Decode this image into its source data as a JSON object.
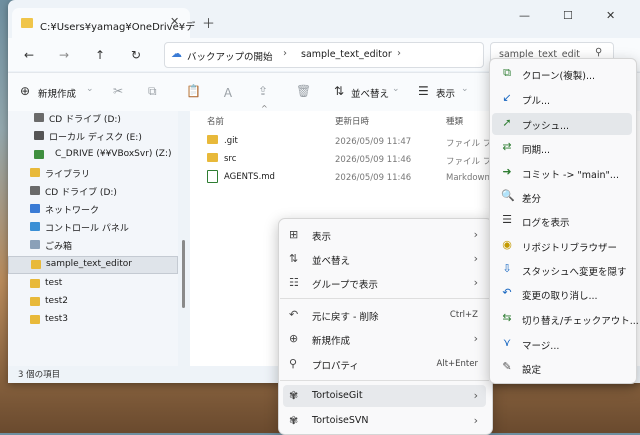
{
  "window": {
    "tab_title": "C:¥Users¥yamag¥OneDrive¥デ",
    "minimize": "—",
    "maximize": "☐",
    "close": "✕"
  },
  "nav": {
    "back": "←",
    "forward": "→",
    "up": "↑",
    "refresh": "↻",
    "breadcrumb": [
      "バックアップの開始",
      "sample_text_editor"
    ],
    "search_placeholder": "sample_text_edit"
  },
  "toolbar": {
    "new_label": "新規作成",
    "sort_label": "並べ替え",
    "view_label": "表示"
  },
  "sidebar": {
    "items": [
      {
        "label": "CD ドライブ (D:)",
        "color": "#6a6a6a"
      },
      {
        "label": "ローカル ディスク (E:)",
        "color": "#555555"
      },
      {
        "label": "C_DRIVE (¥¥VBoxSvr) (Z:)",
        "color": "#3f8f3f"
      },
      {
        "label": "ライブラリ",
        "color": "#e8b93a"
      },
      {
        "label": "CD ドライブ (D:)",
        "color": "#6a6a6a"
      },
      {
        "label": "ネットワーク",
        "color": "#3a7bd5"
      },
      {
        "label": "コントロール パネル",
        "color": "#3a8fd5"
      },
      {
        "label": "ごみ箱",
        "color": "#8aa0b8"
      },
      {
        "label": "sample_text_editor",
        "color": "#e8b93a"
      },
      {
        "label": "test",
        "color": "#e8b93a"
      },
      {
        "label": "test2",
        "color": "#e8b93a"
      },
      {
        "label": "test3",
        "color": "#e8b93a"
      }
    ]
  },
  "files": {
    "headers": [
      "名前",
      "更新日時",
      "種類"
    ],
    "rows": [
      {
        "name": ".git",
        "date": "2026/05/09 11:47",
        "type": "ファイル フォ"
      },
      {
        "name": "src",
        "date": "2026/05/09 11:46",
        "type": "ファイル フォ"
      },
      {
        "name": "AGENTS.md",
        "date": "2026/05/09 11:46",
        "type": "Markdown"
      }
    ]
  },
  "status": "3 個の項目",
  "context_menu": {
    "items": [
      {
        "label": "表示",
        "icon": "⊞",
        "arrow": true
      },
      {
        "label": "並べ替え",
        "icon": "⇅",
        "arrow": true
      },
      {
        "label": "グループで表示",
        "icon": "☷",
        "arrow": true
      },
      {
        "label": "元に戻す - 削除",
        "icon": "↶",
        "shortcut": "Ctrl+Z"
      },
      {
        "label": "新規作成",
        "icon": "⊕",
        "arrow": true
      },
      {
        "label": "プロパティ",
        "icon": "⚲",
        "shortcut": "Alt+Enter"
      },
      {
        "label": "TortoiseGit",
        "icon": "✾",
        "arrow": true
      },
      {
        "label": "TortoiseSVN",
        "icon": "✾",
        "arrow": true
      }
    ]
  },
  "submenu": {
    "items": [
      {
        "label": "クローン(複製)...",
        "icon": "⧉",
        "color": "#2e7d32"
      },
      {
        "label": "プル...",
        "icon": "↙",
        "color": "#1565c0"
      },
      {
        "label": "プッシュ...",
        "icon": "➚",
        "color": "#2e7d32"
      },
      {
        "label": "同期...",
        "icon": "⇄",
        "color": "#2e7d32"
      },
      {
        "label": "コミット -> \"main\"...",
        "icon": "➜",
        "color": "#2e7d32"
      },
      {
        "label": "差分",
        "icon": "🔍",
        "color": "#444444"
      },
      {
        "label": "ログを表示",
        "icon": "☰",
        "color": "#333333"
      },
      {
        "label": "リポジトリブラウザー",
        "icon": "◉",
        "color": "#c49a00"
      },
      {
        "label": "スタッシュへ変更を隠す",
        "icon": "⇩",
        "color": "#1565c0"
      },
      {
        "label": "変更の取り消し...",
        "icon": "↶",
        "color": "#1565c0"
      },
      {
        "label": "切り替え/チェックアウト...",
        "icon": "⇆",
        "color": "#2e7d32"
      },
      {
        "label": "マージ...",
        "icon": "⋎",
        "color": "#1565c0"
      },
      {
        "label": "設定",
        "icon": "✎",
        "color": "#555555"
      }
    ]
  }
}
